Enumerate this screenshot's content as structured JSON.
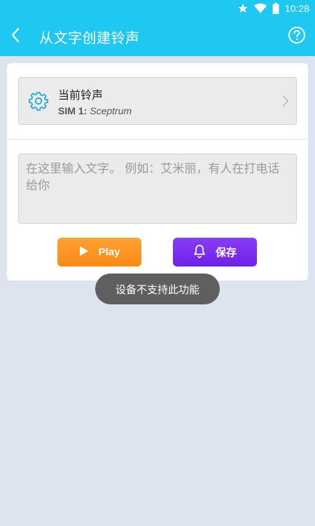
{
  "status_bar": {
    "time": "10:28",
    "icons": [
      "star-icon",
      "wifi-icon",
      "battery-icon"
    ]
  },
  "app_bar": {
    "title": "从文字创建铃声",
    "back_icon": "back-arrow-icon",
    "help_icon": "help-icon"
  },
  "ringtone": {
    "title": "当前铃声",
    "sim_label": "SIM 1:",
    "sim_value": "Sceptrum",
    "icon": "gear-icon"
  },
  "text_input": {
    "placeholder": "在这里输入文字。 例如：艾米丽，有人在打电话给你"
  },
  "buttons": {
    "play_label": "Play",
    "save_label": "保存"
  },
  "toast": {
    "message": "设备不支持此功能"
  },
  "colors": {
    "primary": "#1ec8f0",
    "play": "#fb8a14",
    "save": "#6e22e8",
    "background": "#dde3ef"
  }
}
